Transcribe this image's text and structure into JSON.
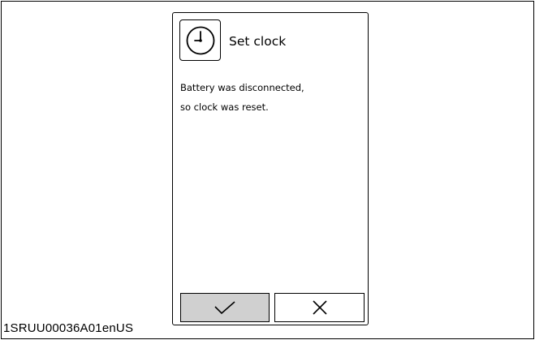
{
  "figure_id": "1SRUU00036A01enUS",
  "dialog": {
    "icon": "clock-icon",
    "title": "Set clock",
    "message_lines": [
      "Battery was disconnected,",
      "so clock was reset."
    ]
  },
  "buttons": {
    "confirm_icon": "checkmark-icon",
    "cancel_icon": "cross-icon"
  },
  "colors": {
    "confirm_button_bg": "#d0d0d0",
    "cancel_button_bg": "#ffffff",
    "line": "#000000"
  }
}
